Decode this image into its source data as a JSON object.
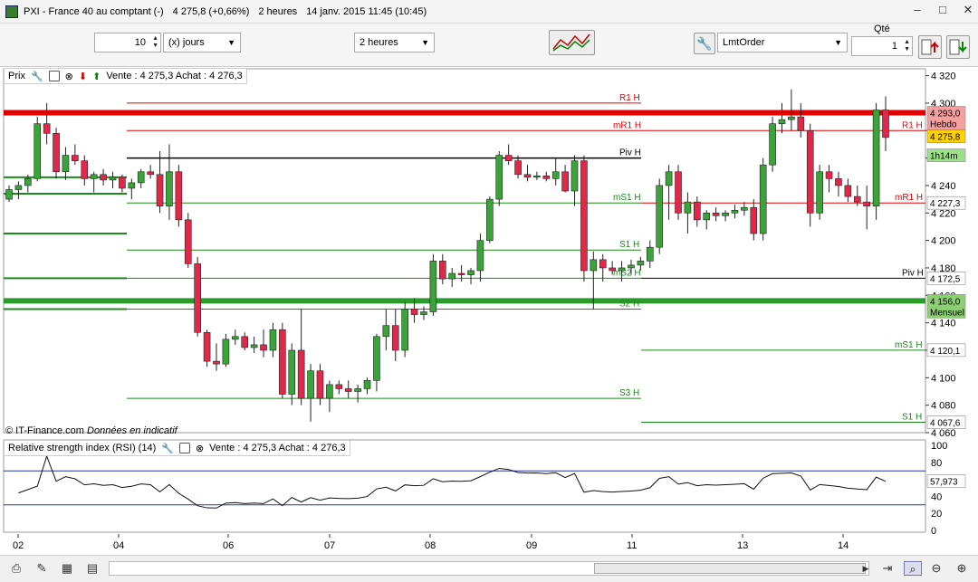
{
  "window": {
    "title": "PXI - France 40 au comptant (-)",
    "price": "4 275,8 (+0,66%)",
    "period": "2 heures",
    "datetime": "14 janv. 2015 11:45 (10:45)"
  },
  "toolbar": {
    "count_value": "10",
    "range_unit": "(x) jours",
    "interval": "2 heures",
    "order_type": "LmtOrder",
    "qty_label": "Qté",
    "qty_value": "1"
  },
  "price_panel": {
    "label": "Prix",
    "quote": "Vente : 4 275,3 Achat : 4 276,3",
    "copyright": "© IT-Finance.com",
    "disclaimer": "Données en indicatif",
    "y_ticks": [
      "4 320",
      "4 300",
      "4 280",
      "4 260",
      "4 240",
      "4 220",
      "4 200",
      "4 180",
      "4 160",
      "4 140",
      "4 120",
      "4 100",
      "4 080",
      "4 060"
    ],
    "tags": [
      {
        "value": "4 293,0",
        "sub": "Hebdo",
        "color": "#f4a0a0"
      },
      {
        "value": "4 275,8",
        "sub": "",
        "color": "#ffd200"
      },
      {
        "value": "1h14m",
        "sub": "",
        "color": "#9de08a"
      },
      {
        "value": "4 227,3",
        "sub": "",
        "color": "#ffffff"
      },
      {
        "value": "4 172,5",
        "sub": "",
        "color": "#ffffff"
      },
      {
        "value": "4 156,0",
        "sub": "Mensuel",
        "color": "#8ecf75"
      },
      {
        "value": "4 120,1",
        "sub": "",
        "color": "#ffffff"
      },
      {
        "value": "4 067,6",
        "sub": "",
        "color": "#ffffff"
      }
    ],
    "level_labels": [
      "R1 H",
      "mR1 H",
      "Piv H",
      "mS1 H",
      "S1 H",
      "mS2 H",
      "S2 H",
      "S3 H",
      "R1 H",
      "mR1 H",
      "Piv H",
      "mS1 H",
      "S1 H"
    ]
  },
  "rsi_panel": {
    "label": "Relative strength index (RSI) (14)",
    "quote": "Vente : 4 275,3 Achat : 4 276,3",
    "y_ticks": [
      "100",
      "80",
      "60",
      "40",
      "20",
      "0"
    ],
    "value": "57,973"
  },
  "x_ticks": [
    "02",
    "04",
    "06",
    "07",
    "08",
    "09",
    "11",
    "13",
    "14"
  ],
  "chart_data": {
    "type": "candlestick",
    "title": "PXI - France 40 au comptant (-)",
    "interval": "2 heures",
    "ylim": [
      4060,
      4325
    ],
    "candles": [
      [
        4230,
        4240,
        4228,
        4237
      ],
      [
        4237,
        4243,
        4230,
        4240
      ],
      [
        4240,
        4248,
        4235,
        4245
      ],
      [
        4245,
        4290,
        4243,
        4285
      ],
      [
        4285,
        4300,
        4270,
        4278
      ],
      [
        4278,
        4282,
        4245,
        4250
      ],
      [
        4250,
        4268,
        4244,
        4262
      ],
      [
        4262,
        4270,
        4255,
        4258
      ],
      [
        4258,
        4262,
        4240,
        4245
      ],
      [
        4245,
        4250,
        4235,
        4248
      ],
      [
        4248,
        4252,
        4240,
        4244
      ],
      [
        4244,
        4250,
        4238,
        4246
      ],
      [
        4246,
        4248,
        4235,
        4238
      ],
      [
        4238,
        4245,
        4230,
        4242
      ],
      [
        4242,
        4252,
        4238,
        4250
      ],
      [
        4250,
        4255,
        4245,
        4248
      ],
      [
        4248,
        4265,
        4220,
        4225
      ],
      [
        4225,
        4270,
        4215,
        4250
      ],
      [
        4250,
        4255,
        4210,
        4215
      ],
      [
        4215,
        4220,
        4180,
        4183
      ],
      [
        4183,
        4188,
        4130,
        4133
      ],
      [
        4133,
        4135,
        4108,
        4112
      ],
      [
        4112,
        4125,
        4105,
        4110
      ],
      [
        4110,
        4132,
        4108,
        4128
      ],
      [
        4128,
        4135,
        4124,
        4130
      ],
      [
        4130,
        4133,
        4120,
        4122
      ],
      [
        4122,
        4130,
        4118,
        4124
      ],
      [
        4124,
        4135,
        4115,
        4120
      ],
      [
        4120,
        4140,
        4115,
        4135
      ],
      [
        4135,
        4140,
        4085,
        4088
      ],
      [
        4088,
        4125,
        4080,
        4120
      ],
      [
        4120,
        4150,
        4080,
        4085
      ],
      [
        4085,
        4110,
        4068,
        4105
      ],
      [
        4105,
        4110,
        4080,
        4085
      ],
      [
        4085,
        4098,
        4075,
        4095
      ],
      [
        4095,
        4098,
        4088,
        4092
      ],
      [
        4092,
        4098,
        4085,
        4090
      ],
      [
        4090,
        4095,
        4082,
        4092
      ],
      [
        4092,
        4100,
        4088,
        4098
      ],
      [
        4098,
        4132,
        4090,
        4130
      ],
      [
        4130,
        4150,
        4120,
        4138
      ],
      [
        4138,
        4150,
        4112,
        4120
      ],
      [
        4120,
        4155,
        4115,
        4150
      ],
      [
        4150,
        4158,
        4140,
        4146
      ],
      [
        4146,
        4152,
        4142,
        4148
      ],
      [
        4148,
        4190,
        4145,
        4185
      ],
      [
        4185,
        4190,
        4168,
        4172
      ],
      [
        4172,
        4180,
        4166,
        4176
      ],
      [
        4176,
        4182,
        4170,
        4175
      ],
      [
        4175,
        4180,
        4168,
        4178
      ],
      [
        4178,
        4205,
        4170,
        4200
      ],
      [
        4200,
        4232,
        4198,
        4230
      ],
      [
        4230,
        4265,
        4225,
        4262
      ],
      [
        4262,
        4270,
        4255,
        4258
      ],
      [
        4258,
        4262,
        4245,
        4248
      ],
      [
        4248,
        4255,
        4243,
        4246
      ],
      [
        4246,
        4250,
        4244,
        4247
      ],
      [
        4247,
        4250,
        4243,
        4245
      ],
      [
        4245,
        4260,
        4240,
        4250
      ],
      [
        4250,
        4255,
        4235,
        4236
      ],
      [
        4236,
        4262,
        4225,
        4258
      ],
      [
        4258,
        4262,
        4170,
        4178
      ],
      [
        4178,
        4192,
        4150,
        4186
      ],
      [
        4186,
        4190,
        4170,
        4180
      ],
      [
        4180,
        4185,
        4175,
        4178
      ],
      [
        4178,
        4185,
        4170,
        4180
      ],
      [
        4180,
        4186,
        4175,
        4182
      ],
      [
        4182,
        4188,
        4178,
        4185
      ],
      [
        4185,
        4200,
        4180,
        4195
      ],
      [
        4195,
        4245,
        4190,
        4240
      ],
      [
        4240,
        4255,
        4215,
        4250
      ],
      [
        4250,
        4255,
        4215,
        4220
      ],
      [
        4220,
        4235,
        4205,
        4228
      ],
      [
        4228,
        4232,
        4210,
        4215
      ],
      [
        4215,
        4222,
        4208,
        4220
      ],
      [
        4220,
        4224,
        4214,
        4218
      ],
      [
        4218,
        4222,
        4214,
        4220
      ],
      [
        4220,
        4226,
        4216,
        4222
      ],
      [
        4222,
        4228,
        4218,
        4224
      ],
      [
        4224,
        4230,
        4200,
        4205
      ],
      [
        4205,
        4260,
        4200,
        4255
      ],
      [
        4255,
        4290,
        4250,
        4285
      ],
      [
        4285,
        4300,
        4278,
        4288
      ],
      [
        4288,
        4310,
        4280,
        4290
      ],
      [
        4290,
        4300,
        4275,
        4280
      ],
      [
        4280,
        4285,
        4210,
        4220
      ],
      [
        4220,
        4255,
        4215,
        4250
      ],
      [
        4250,
        4255,
        4235,
        4245
      ],
      [
        4245,
        4250,
        4232,
        4240
      ],
      [
        4240,
        4245,
        4228,
        4232
      ],
      [
        4232,
        4240,
        4225,
        4228
      ],
      [
        4228,
        4240,
        4208,
        4225
      ],
      [
        4225,
        4300,
        4215,
        4295
      ],
      [
        4295,
        4305,
        4265,
        4275
      ]
    ],
    "levels": [
      {
        "label": "R1 H",
        "value": 4300,
        "color": "#e00000"
      },
      {
        "label": "mR1 H",
        "value": 4280,
        "color": "#e00000"
      },
      {
        "label": "Piv H",
        "value": 4260,
        "color": "#000000"
      },
      {
        "label": "mS1 H",
        "value": 4227.3,
        "color": "#1a8a1a"
      },
      {
        "label": "S1 H",
        "value": 4193,
        "color": "#1a8a1a"
      },
      {
        "label": "mS2 H",
        "value": 4172.5,
        "color": "#1a8a1a"
      },
      {
        "label": "S2 H",
        "value": 4150,
        "color": "#1a8a1a"
      },
      {
        "label": "S3 H",
        "value": 4085,
        "color": "#1a8a1a"
      }
    ],
    "rsi": {
      "ylim": [
        0,
        100
      ],
      "overbought": 70,
      "oversold": 30,
      "last": 57.973
    }
  }
}
